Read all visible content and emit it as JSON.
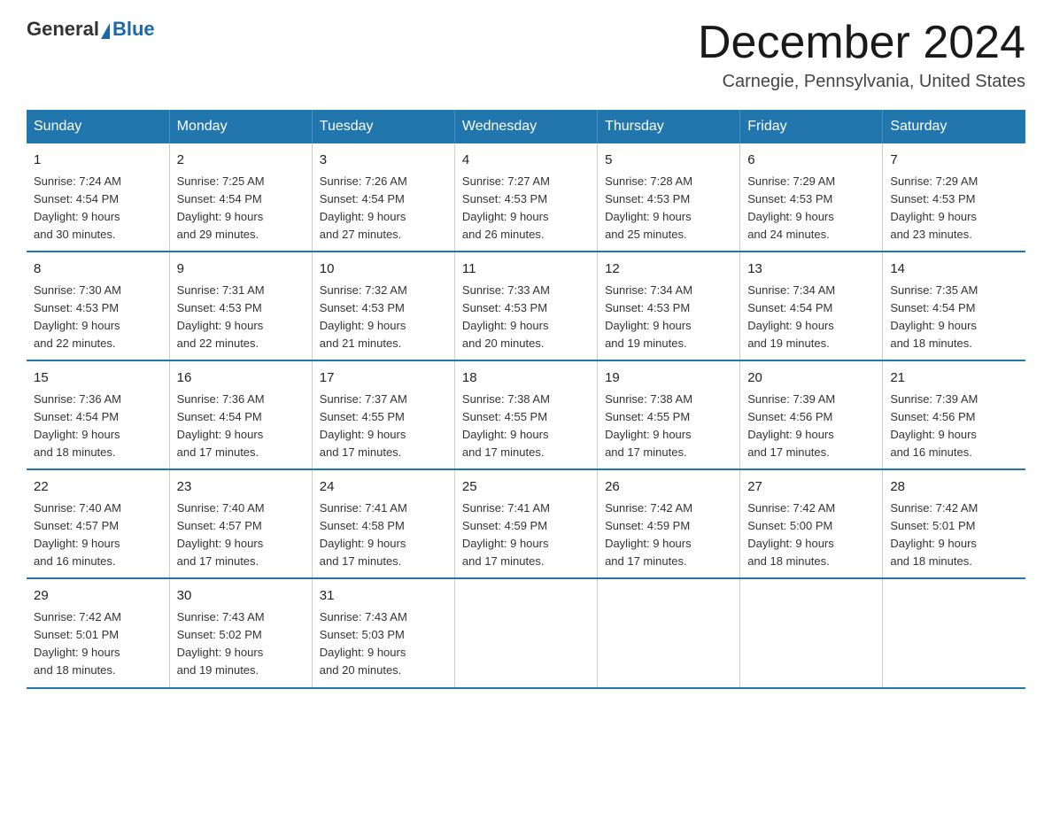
{
  "header": {
    "logo_general": "General",
    "logo_blue": "Blue",
    "month_title": "December 2024",
    "location": "Carnegie, Pennsylvania, United States"
  },
  "days_of_week": [
    "Sunday",
    "Monday",
    "Tuesday",
    "Wednesday",
    "Thursday",
    "Friday",
    "Saturday"
  ],
  "weeks": [
    [
      {
        "day": "1",
        "sunrise": "7:24 AM",
        "sunset": "4:54 PM",
        "daylight": "9 hours and 30 minutes."
      },
      {
        "day": "2",
        "sunrise": "7:25 AM",
        "sunset": "4:54 PM",
        "daylight": "9 hours and 29 minutes."
      },
      {
        "day": "3",
        "sunrise": "7:26 AM",
        "sunset": "4:54 PM",
        "daylight": "9 hours and 27 minutes."
      },
      {
        "day": "4",
        "sunrise": "7:27 AM",
        "sunset": "4:53 PM",
        "daylight": "9 hours and 26 minutes."
      },
      {
        "day": "5",
        "sunrise": "7:28 AM",
        "sunset": "4:53 PM",
        "daylight": "9 hours and 25 minutes."
      },
      {
        "day": "6",
        "sunrise": "7:29 AM",
        "sunset": "4:53 PM",
        "daylight": "9 hours and 24 minutes."
      },
      {
        "day": "7",
        "sunrise": "7:29 AM",
        "sunset": "4:53 PM",
        "daylight": "9 hours and 23 minutes."
      }
    ],
    [
      {
        "day": "8",
        "sunrise": "7:30 AM",
        "sunset": "4:53 PM",
        "daylight": "9 hours and 22 minutes."
      },
      {
        "day": "9",
        "sunrise": "7:31 AM",
        "sunset": "4:53 PM",
        "daylight": "9 hours and 22 minutes."
      },
      {
        "day": "10",
        "sunrise": "7:32 AM",
        "sunset": "4:53 PM",
        "daylight": "9 hours and 21 minutes."
      },
      {
        "day": "11",
        "sunrise": "7:33 AM",
        "sunset": "4:53 PM",
        "daylight": "9 hours and 20 minutes."
      },
      {
        "day": "12",
        "sunrise": "7:34 AM",
        "sunset": "4:53 PM",
        "daylight": "9 hours and 19 minutes."
      },
      {
        "day": "13",
        "sunrise": "7:34 AM",
        "sunset": "4:54 PM",
        "daylight": "9 hours and 19 minutes."
      },
      {
        "day": "14",
        "sunrise": "7:35 AM",
        "sunset": "4:54 PM",
        "daylight": "9 hours and 18 minutes."
      }
    ],
    [
      {
        "day": "15",
        "sunrise": "7:36 AM",
        "sunset": "4:54 PM",
        "daylight": "9 hours and 18 minutes."
      },
      {
        "day": "16",
        "sunrise": "7:36 AM",
        "sunset": "4:54 PM",
        "daylight": "9 hours and 17 minutes."
      },
      {
        "day": "17",
        "sunrise": "7:37 AM",
        "sunset": "4:55 PM",
        "daylight": "9 hours and 17 minutes."
      },
      {
        "day": "18",
        "sunrise": "7:38 AM",
        "sunset": "4:55 PM",
        "daylight": "9 hours and 17 minutes."
      },
      {
        "day": "19",
        "sunrise": "7:38 AM",
        "sunset": "4:55 PM",
        "daylight": "9 hours and 17 minutes."
      },
      {
        "day": "20",
        "sunrise": "7:39 AM",
        "sunset": "4:56 PM",
        "daylight": "9 hours and 17 minutes."
      },
      {
        "day": "21",
        "sunrise": "7:39 AM",
        "sunset": "4:56 PM",
        "daylight": "9 hours and 16 minutes."
      }
    ],
    [
      {
        "day": "22",
        "sunrise": "7:40 AM",
        "sunset": "4:57 PM",
        "daylight": "9 hours and 16 minutes."
      },
      {
        "day": "23",
        "sunrise": "7:40 AM",
        "sunset": "4:57 PM",
        "daylight": "9 hours and 17 minutes."
      },
      {
        "day": "24",
        "sunrise": "7:41 AM",
        "sunset": "4:58 PM",
        "daylight": "9 hours and 17 minutes."
      },
      {
        "day": "25",
        "sunrise": "7:41 AM",
        "sunset": "4:59 PM",
        "daylight": "9 hours and 17 minutes."
      },
      {
        "day": "26",
        "sunrise": "7:42 AM",
        "sunset": "4:59 PM",
        "daylight": "9 hours and 17 minutes."
      },
      {
        "day": "27",
        "sunrise": "7:42 AM",
        "sunset": "5:00 PM",
        "daylight": "9 hours and 18 minutes."
      },
      {
        "day": "28",
        "sunrise": "7:42 AM",
        "sunset": "5:01 PM",
        "daylight": "9 hours and 18 minutes."
      }
    ],
    [
      {
        "day": "29",
        "sunrise": "7:42 AM",
        "sunset": "5:01 PM",
        "daylight": "9 hours and 18 minutes."
      },
      {
        "day": "30",
        "sunrise": "7:43 AM",
        "sunset": "5:02 PM",
        "daylight": "9 hours and 19 minutes."
      },
      {
        "day": "31",
        "sunrise": "7:43 AM",
        "sunset": "5:03 PM",
        "daylight": "9 hours and 20 minutes."
      },
      {
        "day": "",
        "sunrise": "",
        "sunset": "",
        "daylight": ""
      },
      {
        "day": "",
        "sunrise": "",
        "sunset": "",
        "daylight": ""
      },
      {
        "day": "",
        "sunrise": "",
        "sunset": "",
        "daylight": ""
      },
      {
        "day": "",
        "sunrise": "",
        "sunset": "",
        "daylight": ""
      }
    ]
  ],
  "labels": {
    "sunrise": "Sunrise:",
    "sunset": "Sunset:",
    "daylight": "Daylight:"
  }
}
